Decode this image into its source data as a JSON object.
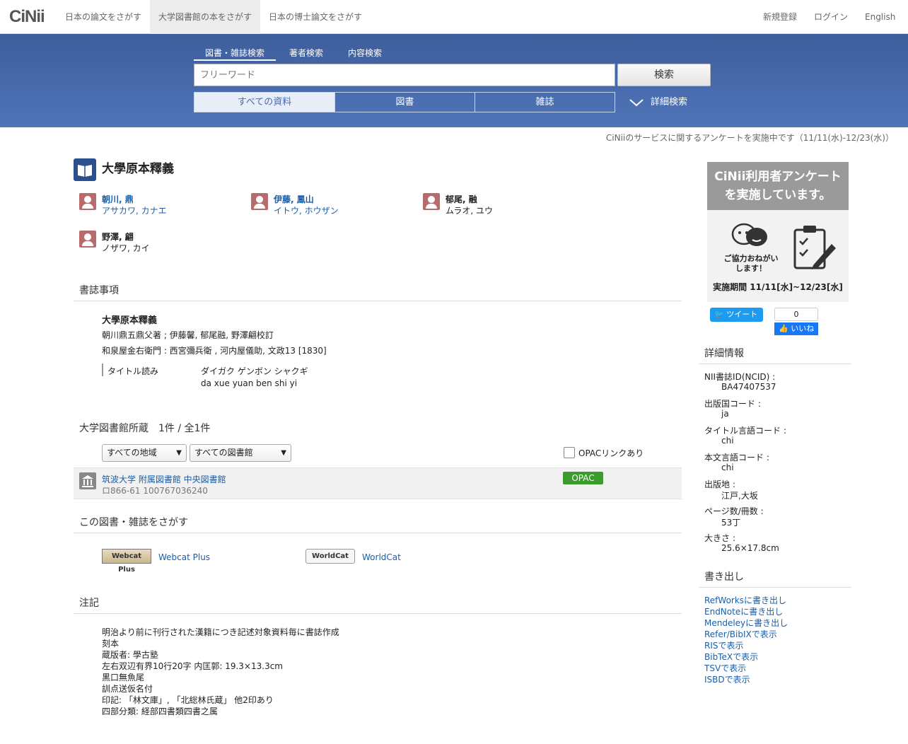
{
  "nav": {
    "logo": "CiNii",
    "tabs": [
      "日本の論文をさがす",
      "大学図書館の本をさがす",
      "日本の博士論文をさがす"
    ],
    "right": [
      "新規登録",
      "ログイン",
      "English"
    ]
  },
  "search": {
    "tabs": [
      "図書・雑誌検索",
      "著者検索",
      "内容検索"
    ],
    "placeholder": "フリーワード",
    "button": "検索",
    "filters": [
      "すべての資料",
      "図書",
      "雑誌"
    ],
    "advanced": "詳細検索"
  },
  "notice": "CiNiiのサービスに関するアンケートを実施中です（11/11(水)-12/23(水)）",
  "book": {
    "title": "大學原本釋義",
    "authors": [
      {
        "name": "朝川, 鼎",
        "kana": "アサカワ, カナエ",
        "link": true
      },
      {
        "name": "伊藤, 鳳山",
        "kana": "イトウ, ホウザン",
        "link": true
      },
      {
        "name": "郁尾, 融",
        "kana": "ムラオ, ユウ",
        "link": false
      },
      {
        "name": "野澤, 翩",
        "kana": "ノザワ, カイ",
        "link": false
      }
    ]
  },
  "bib": {
    "heading": "書誌事項",
    "title": "大學原本釋義",
    "responsibility": "朝川鼎五鼎父著 ; 伊藤馨, 郁尾融, 野澤翩校訂",
    "publication": "和泉屋金右衛門 : 西宮彌兵衛 , 河内屋儀助, 文政13 [1830]",
    "reading_label": "タイトル読み",
    "reading_kana": "ダイガク ゲンボン シャクギ",
    "reading_roman": "da xue yuan ben shi yi"
  },
  "holdings": {
    "heading": "大学図書館所蔵　1件 / 全1件",
    "region_select": "すべての地域",
    "library_select": "すべての図書館",
    "opac_checkbox": "OPACリンクあり",
    "library": "筑波大学 附属図書館 中央図書館",
    "callno": "ロ866-61  100767036240",
    "opac_label": "OPAC"
  },
  "find": {
    "heading": "この図書・雑誌をさがす",
    "webcat_logo": "Webcat Plus",
    "webcat": "Webcat Plus",
    "worldcat_logo": "WorldCat",
    "worldcat": "WorldCat"
  },
  "notes": {
    "heading": "注記",
    "lines": [
      "明治より前に刊行された漢籍につき記述対象資料毎に書誌作成",
      "刻本",
      "蔵版者: 學古塾",
      "左右双辺有界10行20字 内匡郭: 19.3×13.3cm",
      "黒口無魚尾",
      "訓点送仮名付",
      "印記: 「林文庫」, 「北総林氏蔵」 他2印あり",
      "四部分類: 経部四書類四書之属"
    ]
  },
  "banner": {
    "line1": "CiNii利用者アンケート",
    "line2": "を実施しています。",
    "caption1": "ご協力おねがい",
    "caption2": "します！",
    "period": "実施期間 11/11[水]~12/23[水]"
  },
  "social": {
    "tweet": "ツイート",
    "like_count": "0",
    "like": "いいね"
  },
  "details": {
    "heading": "詳細情報",
    "items": [
      {
        "label": "NII書誌ID(NCID) :",
        "value": "BA47407537"
      },
      {
        "label": "出版国コード :",
        "value": "ja"
      },
      {
        "label": "タイトル言語コード :",
        "value": "chi"
      },
      {
        "label": "本文言語コード :",
        "value": "chi"
      },
      {
        "label": "出版地 :",
        "value": "江戸,大坂"
      },
      {
        "label": "ページ数/冊数 :",
        "value": "53丁"
      },
      {
        "label": "大きさ :",
        "value": "25.6×17.8cm"
      }
    ]
  },
  "export": {
    "heading": "書き出し",
    "links": [
      "RefWorksに書き出し",
      "EndNoteに書き出し",
      "Mendeleyに書き出し",
      "Refer/BibIXで表示",
      "RISで表示",
      "BibTeXで表示",
      "TSVで表示",
      "ISBDで表示"
    ]
  }
}
